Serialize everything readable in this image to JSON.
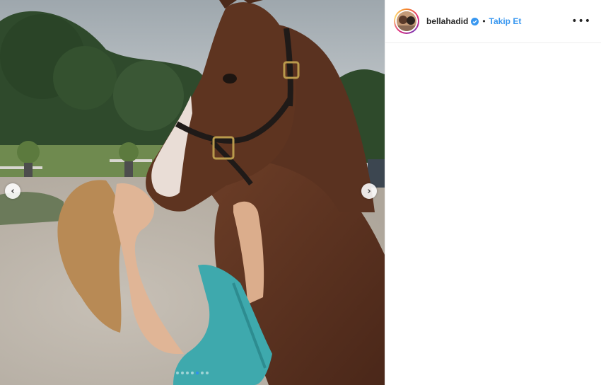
{
  "post": {
    "username": "bellahadid",
    "verified_icon": "verified-badge-icon",
    "separator": "•",
    "follow_label": "Takip Et",
    "more_icon": "more-options-icon",
    "more_glyph": "•••",
    "accent_color": "#3897f0"
  },
  "media": {
    "prev_glyph": "‹",
    "next_glyph": "›",
    "carousel": {
      "total": 7,
      "active_index": 4
    }
  }
}
